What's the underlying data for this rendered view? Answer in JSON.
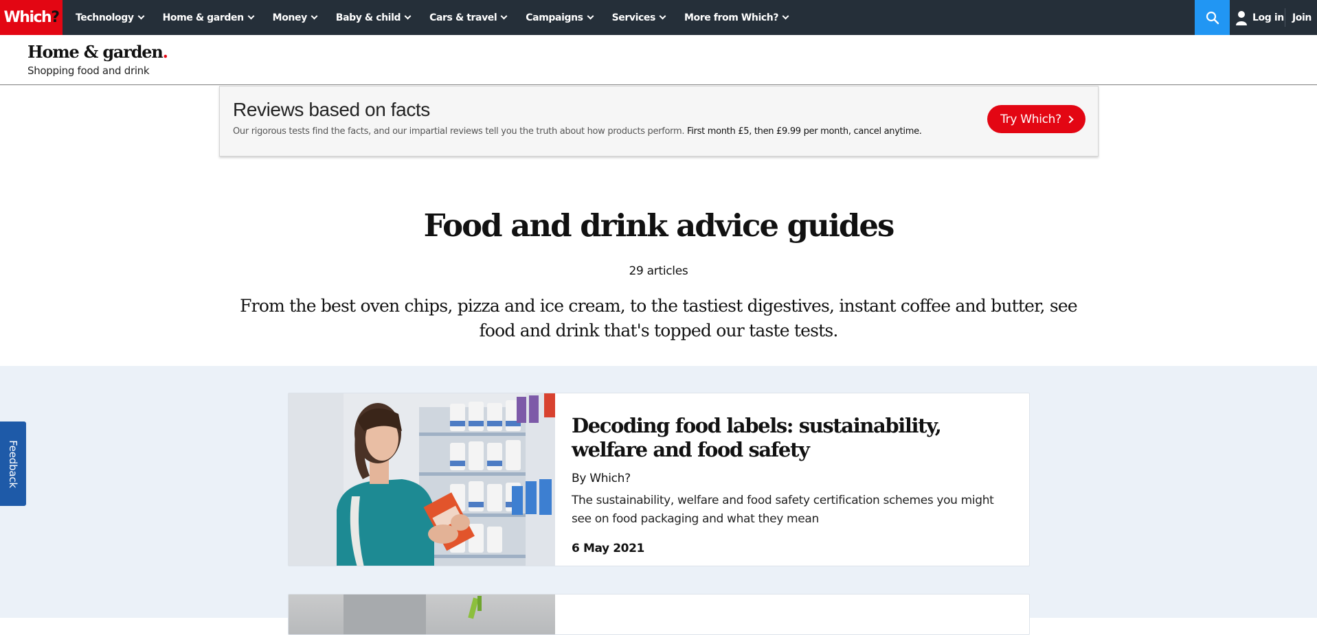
{
  "nav": {
    "logo_text": "Which",
    "logo_mark": "?",
    "items": [
      {
        "label": "Technology"
      },
      {
        "label": "Home & garden"
      },
      {
        "label": "Money"
      },
      {
        "label": "Baby & child"
      },
      {
        "label": "Cars & travel"
      },
      {
        "label": "Campaigns"
      },
      {
        "label": "Services"
      },
      {
        "label": "More from Which?"
      }
    ],
    "search_icon": "search-icon",
    "login_label": "Log in",
    "join_label": "Join",
    "colors": {
      "bar": "#252f39",
      "brand": "#e30613",
      "search": "#2196f3"
    }
  },
  "section": {
    "title": "Home & garden",
    "title_dot": ".",
    "subtitle": "Shopping food and drink"
  },
  "banner": {
    "title": "Reviews based on facts",
    "text": "Our rigorous tests find the facts, and our impartial reviews tell you the truth about how products perform.",
    "text_strong": "First month £5, then £9.99 per month, cancel anytime.",
    "button_label": "Try Which?"
  },
  "main": {
    "title": "Food and drink advice guides",
    "count": "29 articles",
    "intro": "From the best oven chips, pizza and ice cream, to the tastiest digestives, instant coffee and butter, see food and drink that's topped our taste tests."
  },
  "articles": [
    {
      "title": "Decoding food labels: sustainability, welfare and food safety",
      "author": "By Which?",
      "description": "The sustainability, welfare and food safety certification schemes you might see on food packaging and what they mean",
      "date": "6 May 2021",
      "image": "woman-reading-food-carton-in-supermarket"
    }
  ],
  "feedback": {
    "label": "Feedback"
  },
  "colors": {
    "listing_bg": "#ebf1f8",
    "feedback": "#1e5aa8"
  }
}
